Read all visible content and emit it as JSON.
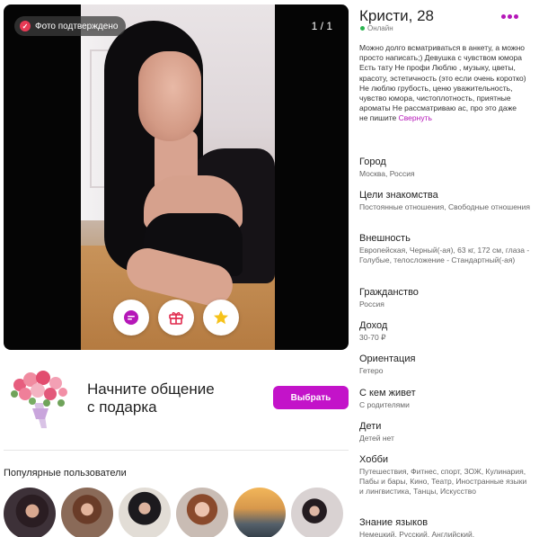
{
  "photo": {
    "verified_label": "Фото подтверждено",
    "counter": "1 / 1",
    "actions": [
      "chat-bubble-icon",
      "gift-icon",
      "star-icon"
    ]
  },
  "gift_banner": {
    "line1": "Начните общение",
    "line2": "с подарка",
    "button_label": "Выбрать"
  },
  "popular": {
    "title": "Популярные пользователи",
    "count": 6
  },
  "profile": {
    "name": "Кристи, 28",
    "status": "Онлайн",
    "about": "Можно долго всматриваться в анкету, а можно просто написать;) Девушка с чувством юмора Есть тату Не профи Люблю , музыку, цветы, красоту, эстетичность (это если очень коротко) Не люблю грубость, ценю уважительность, чувство юмора, чистоплотность, приятные ароматы Не рассматриваю ас, про это даже не пишите",
    "collapse_label": "Свернуть",
    "fields": [
      {
        "label": "Город",
        "value": "Москва, Россия"
      },
      {
        "label": "Цели знакомства",
        "value": "Постоянные отношения, Свободные отношения"
      },
      {
        "label": "Внешность",
        "value": "Европейская, Черный(-ая), 63 кг, 172 см, глаза - Голубые, телосложение - Стандартный(-ая)"
      },
      {
        "label": "Гражданство",
        "value": "Россия"
      },
      {
        "label": "Доход",
        "value": "30-70 ₽"
      },
      {
        "label": "Ориентация",
        "value": "Гетеро"
      },
      {
        "label": "С кем живет",
        "value": "С родителями"
      },
      {
        "label": "Дети",
        "value": "Детей нет"
      },
      {
        "label": "Хобби",
        "value": "Путешествия, Фитнес, спорт, ЗОЖ, Кулинария, Пабы и бары, Кино, Театр, Иностранные языки и лингвистика, Танцы, Искусство"
      },
      {
        "label": "Знание языков",
        "value": "Немецкий, Русский, Английский,"
      }
    ]
  },
  "colors": {
    "accent": "#c313c9",
    "online": "#2bb34f",
    "verified_check": "#e83a55"
  }
}
